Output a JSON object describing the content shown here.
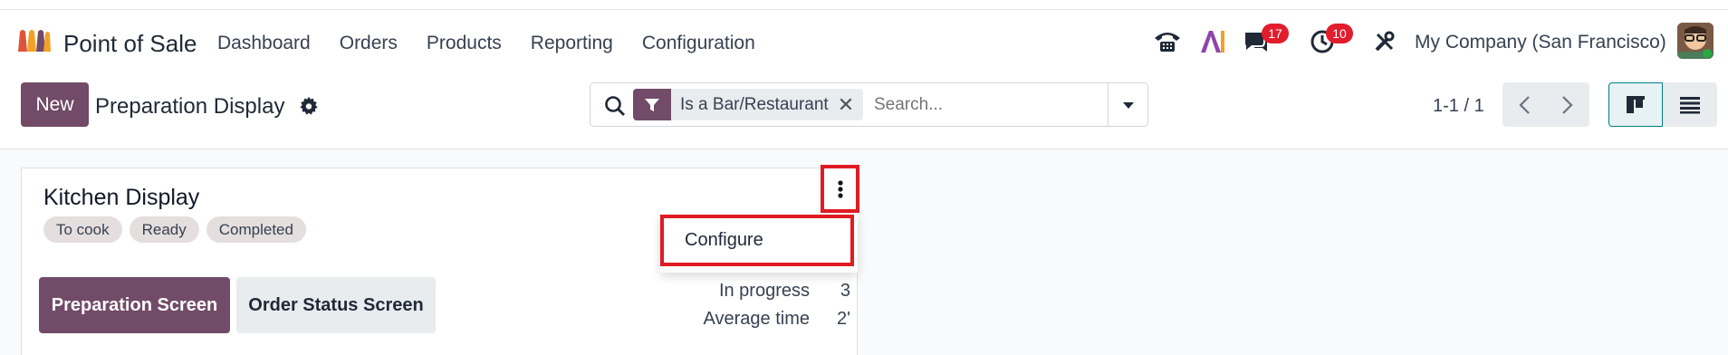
{
  "navbar": {
    "app_name": "Point of Sale",
    "menu": [
      "Dashboard",
      "Orders",
      "Products",
      "Reporting",
      "Configuration"
    ],
    "messages_count": "17",
    "activities_count": "10",
    "company": "My Company (San Francisco)"
  },
  "control": {
    "new_label": "New",
    "title": "Preparation Display",
    "search": {
      "facet_label": "Is a Bar/Restaurant",
      "facet_remove": "✕",
      "placeholder": "Search..."
    },
    "pager": "1-1 / 1"
  },
  "card": {
    "title": "Kitchen Display",
    "tags": [
      "To cook",
      "Ready",
      "Completed"
    ],
    "prep_button": "Preparation Screen",
    "status_button": "Order Status Screen",
    "stats": [
      {
        "label": "In progress",
        "value": "3"
      },
      {
        "label": "Average time",
        "value": "2'"
      }
    ],
    "dropdown_item": "Configure"
  },
  "colors": {
    "brand": "#714b67",
    "badge": "#e11d2e",
    "highlight": "#e01b24"
  },
  "icons": [
    "phone-icon",
    "ai-icon",
    "chat-icon",
    "clock-icon",
    "tools-icon",
    "gear-icon",
    "search-icon",
    "filter-icon",
    "caret-down-icon",
    "chevron-left-icon",
    "chevron-right-icon",
    "kanban-view-icon",
    "list-view-icon",
    "kebab-menu-icon"
  ]
}
